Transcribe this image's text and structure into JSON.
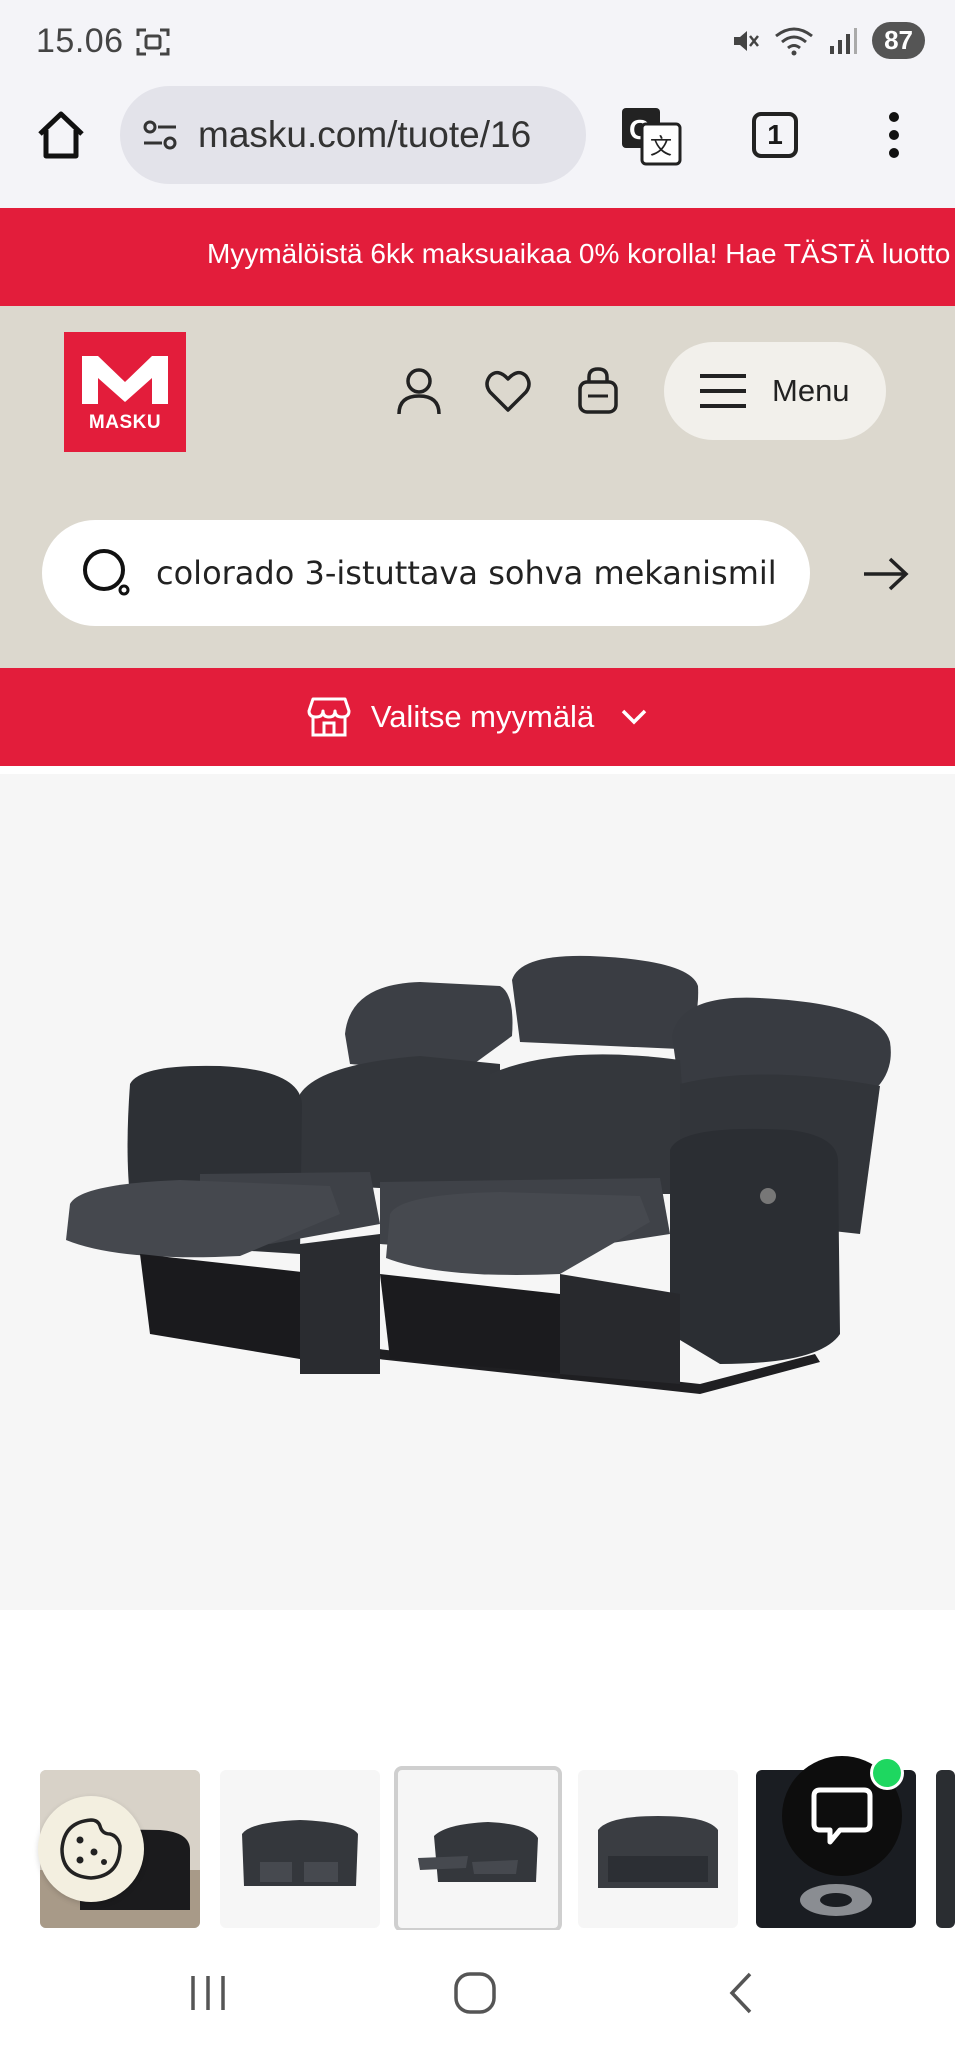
{
  "status_bar": {
    "time": "15.06",
    "battery": "87",
    "icons": [
      "screenshot-icon",
      "mute-icon",
      "wifi-icon",
      "signal-icon"
    ]
  },
  "browser": {
    "url": "masku.com/tuote/16",
    "tab_count": "1",
    "icons": [
      "home-icon",
      "site-settings-icon",
      "translate-icon",
      "more-icon"
    ]
  },
  "promo": {
    "text": "Myymälöistä 6kk maksuaikaa 0% korolla! Hae TÄSTÄ luotto"
  },
  "header": {
    "logo_text": "MASKU",
    "menu_label": "Menu",
    "icons": [
      "account-icon",
      "heart-icon",
      "cart-icon",
      "hamburger-icon"
    ]
  },
  "search": {
    "value": "colorado 3-istuttava sohva mekanismil"
  },
  "store": {
    "label": "Valitse myymälä"
  },
  "gallery": {
    "selected_index": 2,
    "thumbnail_count": 6
  },
  "colors": {
    "brand_red": "#e31d3b",
    "header_beige": "#dcd8ce",
    "chat_online": "#1ed760"
  }
}
